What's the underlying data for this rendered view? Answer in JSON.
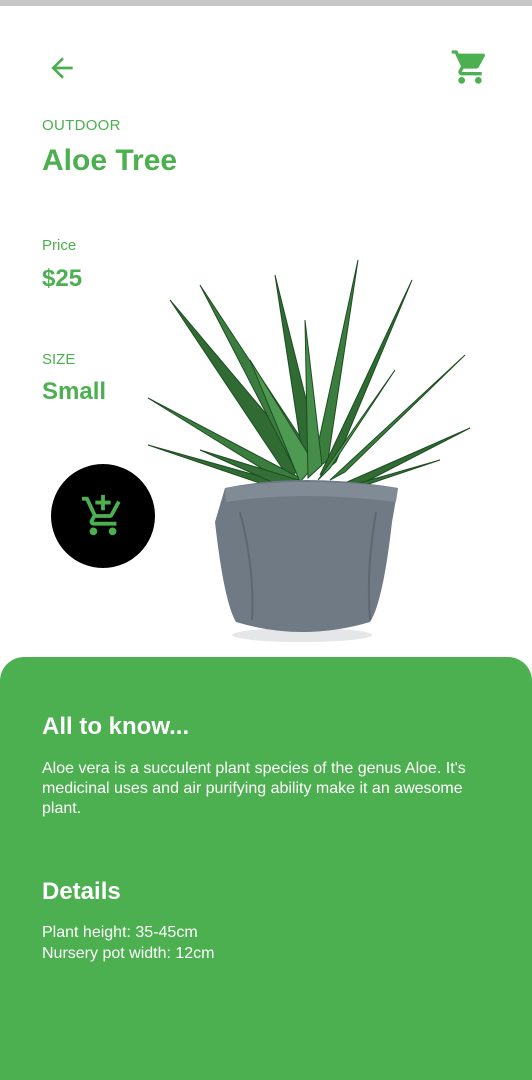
{
  "header": {
    "back_icon": "arrow-left-icon",
    "cart_icon": "shopping-cart-icon"
  },
  "product": {
    "category": "OUTDOOR",
    "name": "Aloe Tree",
    "price_label": "Price",
    "price": "$25",
    "size_label": "SIZE",
    "size": "Small",
    "image": "aloe-plant-in-grey-pot"
  },
  "actions": {
    "add_to_cart_icon": "add-to-cart-icon"
  },
  "info": {
    "about_heading": "All to know...",
    "about_text": "Aloe vera is a succulent plant species of the genus Aloe. It's medicinal uses and air purifying ability make it an awesome plant.",
    "details_heading": "Details",
    "details": [
      "Plant height: 35-45cm",
      "Nursery pot width: 12cm"
    ]
  },
  "colors": {
    "accent": "#4caf50",
    "fab_background": "#000000",
    "pot": "#6f7a85"
  }
}
